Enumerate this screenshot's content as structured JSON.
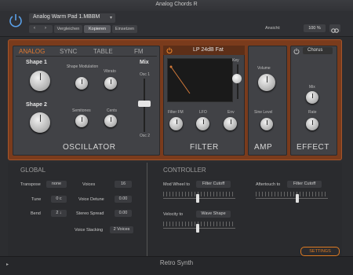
{
  "window": {
    "title": "Analog Chords R"
  },
  "header": {
    "preset": "Analog Warm Pad 1.MBBM",
    "buttons": {
      "compare": "Vergleichen",
      "copy": "Kopieren",
      "paste": "Einsetzen"
    },
    "view_label": "Ansicht:",
    "zoom": "100 %"
  },
  "oscillator": {
    "tabs": [
      "ANALOG",
      "SYNC",
      "TABLE",
      "FM"
    ],
    "active_tab": "ANALOG",
    "shape1": "Shape 1",
    "shape2": "Shape 2",
    "shape_mod": "Shape Modulation",
    "vibrato": "Vibrato",
    "semitones": "Semitones",
    "cents": "Cents",
    "mix": "Mix",
    "osc1": "Osc 1",
    "osc2": "Osc 2",
    "section": "OSCILLATOR"
  },
  "filter": {
    "type": "LP 24dB Fat",
    "key": "Key",
    "filter_fm": "Filter FM",
    "lfo": "LFO",
    "env": "Env",
    "section": "FILTER"
  },
  "amp": {
    "volume": "Volume",
    "sine_level": "Sine Level",
    "section": "AMP"
  },
  "effect": {
    "type": "Chorus",
    "mix": "Mix",
    "rate": "Rate",
    "section": "EFFECT"
  },
  "global": {
    "title": "GLOBAL",
    "transpose_label": "Transpose",
    "transpose_value": "none",
    "tune_label": "Tune",
    "tune_value": "0 c",
    "bend_label": "Bend",
    "bend_value": "2 ↓",
    "voices_label": "Voices",
    "voices_value": "16",
    "voice_detune_label": "Voice Detune",
    "voice_detune_value": "0.00",
    "stereo_spread_label": "Stereo Spread",
    "stereo_spread_value": "0.00",
    "voice_stacking_label": "Voice Stacking",
    "voice_stacking_value": "2 Voices"
  },
  "controller": {
    "title": "CONTROLLER",
    "mod_wheel_label": "Mod Wheel to",
    "mod_wheel_value": "Filter Cutoff",
    "aftertouch_label": "Aftertouch to",
    "aftertouch_value": "Filter Cutoff",
    "velocity_label": "Velocity to",
    "velocity_value": "Wave Shape"
  },
  "footer": {
    "name": "Retro Synth",
    "settings": "SETTINGS"
  }
}
